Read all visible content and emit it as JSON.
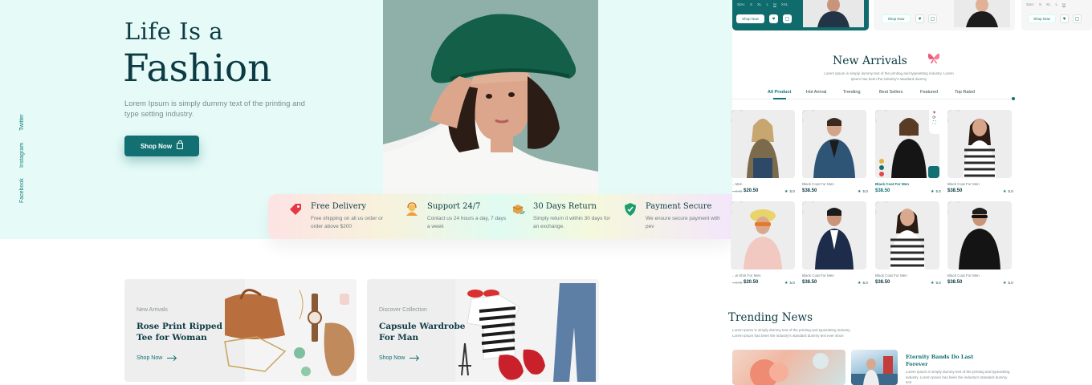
{
  "social": [
    "Twitter",
    "Instagram",
    "Facebook"
  ],
  "hero": {
    "title_line1": "Life Is a",
    "title_line2": "Fashion",
    "description": "Lorem Ipsum is simply dummy text of the printing and type setting industry.",
    "button_label": "Shop Now"
  },
  "features": [
    {
      "title": "Free Delivery",
      "desc": "Free shipping on all us order or order above $200",
      "icon": "delivery-tag-icon"
    },
    {
      "title": "Support 24/7",
      "desc": "Contact us 24 hours a day, 7 days a week",
      "icon": "support-agent-icon"
    },
    {
      "title": "30 Days Return",
      "desc": "Simply return it within 30 days for an exchange.",
      "icon": "return-box-icon"
    },
    {
      "title": "Payment Secure",
      "desc": "We ensure secure payment with pev",
      "icon": "shield-check-icon"
    }
  ],
  "promos": [
    {
      "tag": "New Arrivals",
      "title": "Rose Print Ripped Tee for Woman",
      "link": "Shop Now"
    },
    {
      "tag": "Discover Collection",
      "title": "Capsule Wardrobe For Man",
      "link": "Shop Now"
    }
  ],
  "top_cards": {
    "size_label": "Size:",
    "sizes": [
      "S",
      "XL",
      "L",
      "M",
      "XXL"
    ],
    "shop_label": "Shop Now"
  },
  "new_arrivals": {
    "title": "New Arrivals",
    "description": "Lorem Ipsum is simply dummy text of the printing and typesetting industry. Lorem Ipsum has been the industry's standard dummy",
    "tabs": [
      "All Product",
      "Hot Arrival",
      "Trending",
      "Best Sellers",
      "Featured",
      "Top Rated"
    ],
    "products": [
      {
        "name": "...Men",
        "price": "$20.50",
        "old": "...0.50",
        "rating": "5.0",
        "highlight": false
      },
      {
        "name": "Black Coat For Men",
        "price": "$38.50",
        "old": "",
        "rating": "5.0",
        "highlight": false
      },
      {
        "name": "Black Coat For Men",
        "price": "$38.50",
        "old": "",
        "rating": "5.0",
        "highlight": true
      },
      {
        "name": "Black Coat For Men",
        "price": "$38.50",
        "old": "",
        "rating": "5.0",
        "highlight": false
      },
      {
        "name": "...w Shirt For Men",
        "price": "$20.50",
        "old": "...0.50",
        "rating": "5.0",
        "highlight": false
      },
      {
        "name": "Black Coat For Men",
        "price": "$38.50",
        "old": "",
        "rating": "5.0",
        "highlight": false
      },
      {
        "name": "Black Coat For Men",
        "price": "$38.50",
        "old": "",
        "rating": "5.0",
        "highlight": false
      },
      {
        "name": "Black Coat For Men",
        "price": "$38.50",
        "old": "",
        "rating": "5.0",
        "highlight": false
      }
    ]
  },
  "trending_news": {
    "title": "Trending News",
    "description": "Lorem Ipsum is simply dummy text of the printing and typesetting industry. Lorem Ipsum has been the industry's standard dummy text ever since",
    "article_title": "Eternity Bands Do Last Forever",
    "article_desc": "Lorem Ipsum is simply dummy text of the printing and typesetting industry. Lorem Ipsum has been the industry's standard dummy text"
  },
  "colors": {
    "accent": "#127072",
    "hero_bg": "#e6fbf8",
    "heading": "#0d3b44"
  }
}
